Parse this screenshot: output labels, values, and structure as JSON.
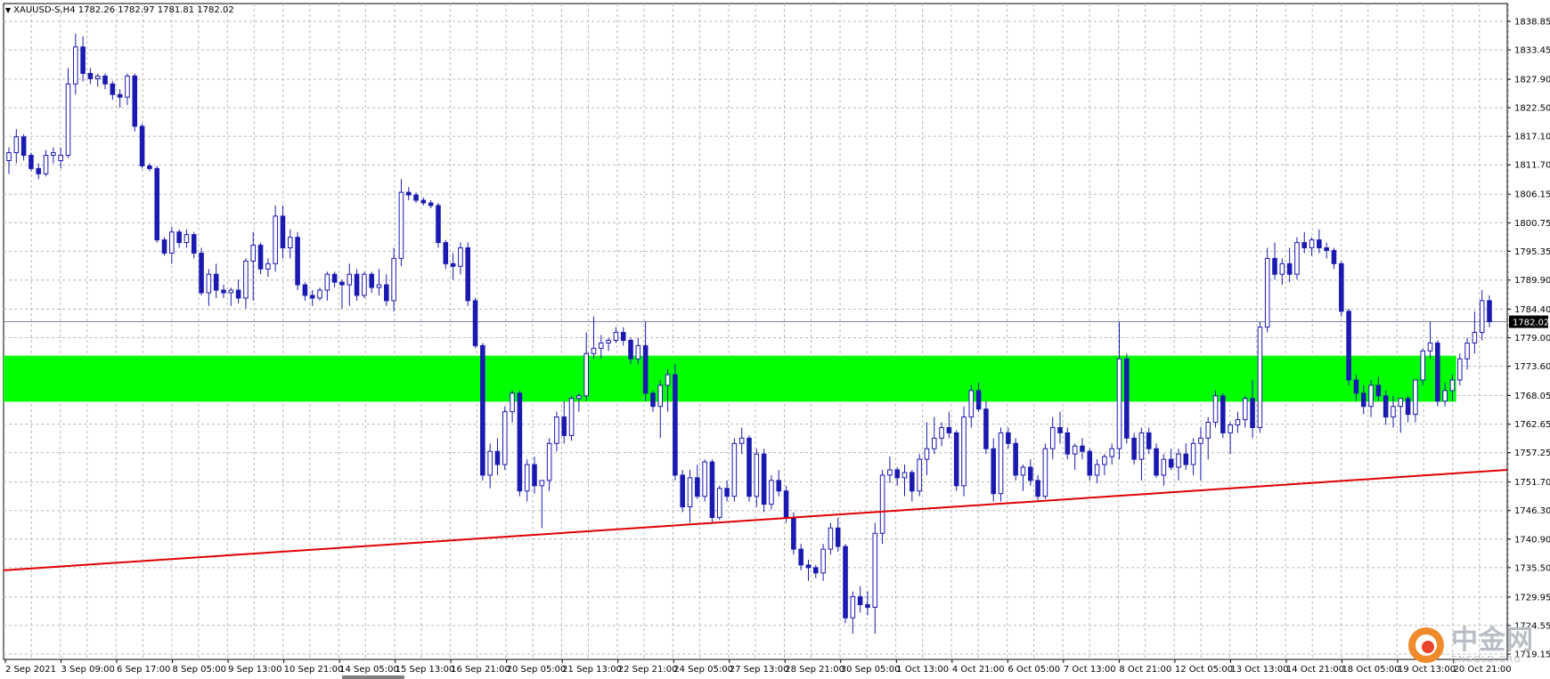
{
  "chart_data": {
    "type": "candlestick",
    "title": "XAUUSD-S,H4  1782.26 1782.97 1781.81 1782.02",
    "ylim": [
      1719.15,
      1841.2
    ],
    "y_ticks": [
      "1838.85",
      "1833.45",
      "1827.90",
      "1822.50",
      "1817.10",
      "1811.70",
      "1806.15",
      "1800.75",
      "1795.35",
      "1789.90",
      "1784.40",
      "1779.00",
      "1773.60",
      "1768.05",
      "1762.65",
      "1757.25",
      "1751.70",
      "1746.30",
      "1740.90",
      "1735.50",
      "1729.95",
      "1724.55",
      "1719.15"
    ],
    "x_labels": [
      "2 Sep 2021",
      "3 Sep 09:00",
      "6 Sep 17:00",
      "8 Sep 05:00",
      "9 Sep 13:00",
      "10 Sep 21:00",
      "14 Sep 05:00",
      "15 Sep 13:00",
      "16 Sep 21:00",
      "20 Sep 05:00",
      "21 Sep 13:00",
      "22 Sep 21:00",
      "24 Sep 05:00",
      "27 Sep 13:00",
      "28 Sep 21:00",
      "30 Sep 05:00",
      "1 Oct 13:00",
      "4 Oct 21:00",
      "6 Oct 05:00",
      "7 Oct 13:00",
      "8 Oct 21:00",
      "12 Oct 05:00",
      "13 Oct 13:00",
      "14 Oct 21:00",
      "18 Oct 05:00",
      "19 Oct 13:00",
      "20 Oct 21:00"
    ],
    "current_price": "1782.02",
    "grid": true,
    "candle_color": "#1a1ab0",
    "zone": {
      "low": 1766.9,
      "high": 1775.6,
      "color": "#00ff00"
    },
    "trendline": {
      "from": [
        0,
        1735.0
      ],
      "to": [
        1,
        1754.0
      ],
      "color": "#e00000"
    },
    "ohlc": [
      [
        1812.5,
        1815.0,
        1810.0,
        1814.0
      ],
      [
        1814.0,
        1818.5,
        1812.0,
        1817.0
      ],
      [
        1817.0,
        1817.5,
        1812.5,
        1813.5
      ],
      [
        1813.5,
        1814.0,
        1810.5,
        1811.0
      ],
      [
        1811.0,
        1812.0,
        1809.0,
        1810.0
      ],
      [
        1810.0,
        1814.5,
        1809.5,
        1813.5
      ],
      [
        1813.5,
        1815.0,
        1812.0,
        1814.0
      ],
      [
        1812.5,
        1815.0,
        1811.0,
        1813.5
      ],
      [
        1813.5,
        1830.0,
        1813.0,
        1827.0
      ],
      [
        1827.0,
        1836.5,
        1825.0,
        1834.0
      ],
      [
        1834.0,
        1836.0,
        1827.5,
        1829.0
      ],
      [
        1829.0,
        1830.0,
        1827.0,
        1828.0
      ],
      [
        1828.0,
        1829.0,
        1826.5,
        1828.5
      ],
      [
        1828.5,
        1829.0,
        1826.0,
        1827.0
      ],
      [
        1827.0,
        1827.5,
        1824.0,
        1825.0
      ],
      [
        1825.0,
        1826.0,
        1822.5,
        1824.5
      ],
      [
        1824.5,
        1829.0,
        1823.0,
        1828.5
      ],
      [
        1828.5,
        1829.0,
        1818.0,
        1819.0
      ],
      [
        1819.0,
        1819.5,
        1811.0,
        1811.5
      ],
      [
        1811.5,
        1812.0,
        1810.5,
        1811.0
      ],
      [
        1811.0,
        1811.5,
        1797.0,
        1797.5
      ],
      [
        1797.5,
        1798.0,
        1794.5,
        1795.0
      ],
      [
        1795.0,
        1800.0,
        1793.0,
        1799.0
      ],
      [
        1799.0,
        1799.5,
        1796.0,
        1797.0
      ],
      [
        1797.0,
        1799.5,
        1796.0,
        1798.5
      ],
      [
        1798.5,
        1799.0,
        1794.0,
        1795.0
      ],
      [
        1795.0,
        1796.0,
        1787.0,
        1787.5
      ],
      [
        1787.5,
        1792.0,
        1785.0,
        1791.0
      ],
      [
        1791.0,
        1793.0,
        1786.5,
        1788.0
      ],
      [
        1788.0,
        1789.0,
        1786.5,
        1787.5
      ],
      [
        1787.5,
        1788.5,
        1785.0,
        1788.0
      ],
      [
        1788.0,
        1790.0,
        1785.5,
        1786.5
      ],
      [
        1786.5,
        1794.0,
        1784.5,
        1793.5
      ],
      [
        1793.5,
        1799.0,
        1786.0,
        1796.5
      ],
      [
        1796.5,
        1797.0,
        1791.0,
        1792.0
      ],
      [
        1792.0,
        1794.0,
        1790.5,
        1793.0
      ],
      [
        1793.0,
        1804.0,
        1791.5,
        1802.0
      ],
      [
        1802.0,
        1804.0,
        1794.0,
        1796.0
      ],
      [
        1796.0,
        1799.5,
        1794.0,
        1798.0
      ],
      [
        1798.0,
        1799.0,
        1788.0,
        1789.0
      ],
      [
        1789.0,
        1789.5,
        1786.0,
        1787.0
      ],
      [
        1787.0,
        1788.0,
        1785.0,
        1786.5
      ],
      [
        1786.5,
        1788.5,
        1786.0,
        1788.0
      ],
      [
        1788.0,
        1791.5,
        1786.0,
        1791.0
      ],
      [
        1791.0,
        1791.5,
        1788.5,
        1789.5
      ],
      [
        1789.5,
        1790.0,
        1784.5,
        1789.0
      ],
      [
        1789.0,
        1793.0,
        1785.0,
        1791.0
      ],
      [
        1791.0,
        1792.0,
        1786.0,
        1787.0
      ],
      [
        1787.0,
        1791.5,
        1786.5,
        1791.0
      ],
      [
        1791.0,
        1791.5,
        1787.5,
        1788.5
      ],
      [
        1788.5,
        1792.0,
        1787.0,
        1789.0
      ],
      [
        1789.0,
        1791.0,
        1785.0,
        1786.0
      ],
      [
        1786.0,
        1796.0,
        1784.0,
        1794.0
      ],
      [
        1794.0,
        1809.0,
        1792.5,
        1806.5
      ],
      [
        1806.5,
        1807.5,
        1805.0,
        1806.0
      ],
      [
        1806.0,
        1806.5,
        1804.5,
        1805.0
      ],
      [
        1805.0,
        1805.5,
        1804.0,
        1804.5
      ],
      [
        1804.5,
        1805.0,
        1803.5,
        1804.0
      ],
      [
        1804.0,
        1804.5,
        1796.0,
        1797.0
      ],
      [
        1797.0,
        1797.5,
        1792.0,
        1793.0
      ],
      [
        1793.0,
        1795.0,
        1790.0,
        1792.5
      ],
      [
        1792.5,
        1797.0,
        1791.0,
        1796.0
      ],
      [
        1796.0,
        1797.0,
        1785.0,
        1786.0
      ],
      [
        1786.0,
        1786.5,
        1777.0,
        1777.5
      ],
      [
        1777.5,
        1778.0,
        1752.0,
        1753.0
      ],
      [
        1753.0,
        1759.0,
        1750.5,
        1757.5
      ],
      [
        1757.5,
        1760.0,
        1753.0,
        1755.0
      ],
      [
        1755.0,
        1766.0,
        1754.0,
        1765.0
      ],
      [
        1765.0,
        1769.0,
        1763.0,
        1768.5
      ],
      [
        1768.5,
        1769.0,
        1749.0,
        1750.0
      ],
      [
        1750.0,
        1756.0,
        1748.0,
        1755.0
      ],
      [
        1755.0,
        1756.5,
        1749.5,
        1751.0
      ],
      [
        1751.0,
        1752.0,
        1743.0,
        1752.0
      ],
      [
        1752.0,
        1760.0,
        1750.0,
        1759.0
      ],
      [
        1759.0,
        1765.0,
        1757.5,
        1764.0
      ],
      [
        1764.0,
        1767.0,
        1759.0,
        1760.5
      ],
      [
        1760.5,
        1768.0,
        1759.5,
        1767.5
      ],
      [
        1767.5,
        1768.5,
        1765.0,
        1768.0
      ],
      [
        1768.0,
        1780.0,
        1767.0,
        1776.0
      ],
      [
        1776.0,
        1783.0,
        1775.0,
        1777.0
      ],
      [
        1777.0,
        1779.5,
        1775.0,
        1778.0
      ],
      [
        1778.0,
        1779.0,
        1776.5,
        1778.5
      ],
      [
        1778.5,
        1781.0,
        1778.0,
        1780.0
      ],
      [
        1780.0,
        1781.0,
        1777.5,
        1778.5
      ],
      [
        1778.5,
        1779.0,
        1774.0,
        1775.0
      ],
      [
        1775.0,
        1779.0,
        1774.0,
        1777.5
      ],
      [
        1777.5,
        1782.0,
        1767.0,
        1768.5
      ],
      [
        1768.5,
        1769.0,
        1765.0,
        1766.0
      ],
      [
        1766.0,
        1771.0,
        1760.0,
        1770.0
      ],
      [
        1770.0,
        1773.0,
        1765.0,
        1772.0
      ],
      [
        1772.0,
        1774.0,
        1752.0,
        1753.0
      ],
      [
        1753.0,
        1754.0,
        1746.0,
        1747.0
      ],
      [
        1747.0,
        1754.0,
        1744.0,
        1752.5
      ],
      [
        1752.5,
        1755.0,
        1748.5,
        1749.0
      ],
      [
        1749.0,
        1756.0,
        1748.0,
        1755.5
      ],
      [
        1755.5,
        1756.0,
        1744.0,
        1745.0
      ],
      [
        1745.0,
        1751.0,
        1744.5,
        1750.5
      ],
      [
        1750.5,
        1752.0,
        1748.0,
        1749.0
      ],
      [
        1749.0,
        1760.0,
        1748.0,
        1759.0
      ],
      [
        1759.0,
        1762.0,
        1757.0,
        1760.0
      ],
      [
        1760.0,
        1760.5,
        1748.0,
        1749.0
      ],
      [
        1749.0,
        1758.0,
        1747.0,
        1757.0
      ],
      [
        1757.0,
        1758.0,
        1746.0,
        1747.5
      ],
      [
        1747.5,
        1753.0,
        1746.5,
        1752.0
      ],
      [
        1752.0,
        1754.0,
        1749.0,
        1750.0
      ],
      [
        1750.0,
        1751.0,
        1744.0,
        1745.0
      ],
      [
        1745.0,
        1746.0,
        1738.0,
        1739.0
      ],
      [
        1739.0,
        1740.0,
        1735.0,
        1736.0
      ],
      [
        1736.0,
        1737.0,
        1733.0,
        1735.5
      ],
      [
        1735.5,
        1736.0,
        1733.5,
        1734.5
      ],
      [
        1734.5,
        1740.0,
        1733.0,
        1739.0
      ],
      [
        1739.0,
        1744.0,
        1738.0,
        1743.0
      ],
      [
        1743.0,
        1745.0,
        1738.5,
        1739.5
      ],
      [
        1739.5,
        1740.0,
        1725.0,
        1726.0
      ],
      [
        1726.0,
        1731.0,
        1723.0,
        1730.0
      ],
      [
        1730.0,
        1732.0,
        1727.0,
        1728.5
      ],
      [
        1728.5,
        1731.0,
        1726.5,
        1728.0
      ],
      [
        1728.0,
        1744.0,
        1723.0,
        1742.0
      ],
      [
        1742.0,
        1754.0,
        1740.0,
        1753.0
      ],
      [
        1753.0,
        1756.5,
        1751.5,
        1754.0
      ],
      [
        1754.0,
        1754.5,
        1751.0,
        1752.5
      ],
      [
        1752.5,
        1755.0,
        1749.0,
        1753.5
      ],
      [
        1753.5,
        1754.0,
        1748.0,
        1750.0
      ],
      [
        1750.0,
        1757.0,
        1749.0,
        1756.0
      ],
      [
        1756.0,
        1763.0,
        1753.0,
        1758.0
      ],
      [
        1758.0,
        1764.0,
        1757.0,
        1760.0
      ],
      [
        1760.0,
        1763.0,
        1758.5,
        1762.0
      ],
      [
        1762.0,
        1765.0,
        1760.0,
        1761.0
      ],
      [
        1761.0,
        1761.5,
        1750.0,
        1751.0
      ],
      [
        1751.0,
        1766.0,
        1749.0,
        1764.0
      ],
      [
        1764.0,
        1770.0,
        1762.0,
        1769.0
      ],
      [
        1769.0,
        1770.5,
        1765.0,
        1765.5
      ],
      [
        1765.5,
        1767.0,
        1757.0,
        1758.0
      ],
      [
        1758.0,
        1760.0,
        1748.0,
        1749.5
      ],
      [
        1749.5,
        1762.0,
        1748.0,
        1761.0
      ],
      [
        1761.0,
        1762.0,
        1758.0,
        1759.0
      ],
      [
        1759.0,
        1760.0,
        1752.0,
        1753.0
      ],
      [
        1753.0,
        1755.0,
        1750.0,
        1754.5
      ],
      [
        1754.5,
        1756.0,
        1751.0,
        1752.0
      ],
      [
        1752.0,
        1753.0,
        1748.0,
        1749.0
      ],
      [
        1749.0,
        1759.0,
        1748.5,
        1758.0
      ],
      [
        1758.0,
        1764.0,
        1756.0,
        1762.0
      ],
      [
        1762.0,
        1765.0,
        1759.0,
        1761.0
      ],
      [
        1761.0,
        1762.0,
        1756.0,
        1757.0
      ],
      [
        1757.0,
        1759.0,
        1754.0,
        1758.5
      ],
      [
        1758.5,
        1760.0,
        1756.0,
        1757.5
      ],
      [
        1757.5,
        1758.0,
        1752.0,
        1753.0
      ],
      [
        1753.0,
        1756.0,
        1751.5,
        1755.0
      ],
      [
        1755.0,
        1757.0,
        1753.0,
        1756.5
      ],
      [
        1756.5,
        1759.0,
        1755.0,
        1758.0
      ],
      [
        1758.0,
        1782.0,
        1756.0,
        1775.0
      ],
      [
        1775.0,
        1776.0,
        1759.0,
        1760.0
      ],
      [
        1760.0,
        1761.0,
        1755.0,
        1756.0
      ],
      [
        1756.0,
        1762.0,
        1752.0,
        1761.0
      ],
      [
        1761.0,
        1762.0,
        1757.0,
        1758.0
      ],
      [
        1758.0,
        1759.0,
        1752.5,
        1753.0
      ],
      [
        1753.0,
        1757.0,
        1751.0,
        1756.0
      ],
      [
        1756.0,
        1758.0,
        1754.0,
        1754.5
      ],
      [
        1754.5,
        1758.0,
        1752.0,
        1757.0
      ],
      [
        1757.0,
        1759.0,
        1754.0,
        1755.0
      ],
      [
        1755.0,
        1760.0,
        1753.0,
        1759.0
      ],
      [
        1759.0,
        1762.0,
        1752.0,
        1760.0
      ],
      [
        1760.0,
        1764.0,
        1756.0,
        1763.0
      ],
      [
        1763.0,
        1769.0,
        1762.0,
        1768.0
      ],
      [
        1768.0,
        1768.5,
        1760.0,
        1761.0
      ],
      [
        1761.0,
        1763.0,
        1757.0,
        1762.5
      ],
      [
        1762.5,
        1765.0,
        1761.0,
        1763.5
      ],
      [
        1763.5,
        1768.0,
        1762.0,
        1767.5
      ],
      [
        1767.5,
        1771.0,
        1760.0,
        1762.0
      ],
      [
        1762.0,
        1782.0,
        1761.0,
        1781.0
      ],
      [
        1781.0,
        1796.0,
        1780.0,
        1794.0
      ],
      [
        1794.0,
        1797.0,
        1790.0,
        1791.0
      ],
      [
        1791.0,
        1794.0,
        1789.0,
        1793.0
      ],
      [
        1793.0,
        1796.0,
        1789.5,
        1791.0
      ],
      [
        1791.0,
        1798.0,
        1790.0,
        1797.0
      ],
      [
        1797.0,
        1799.0,
        1795.0,
        1796.0
      ],
      [
        1796.0,
        1798.0,
        1794.5,
        1797.5
      ],
      [
        1797.5,
        1799.5,
        1795.0,
        1796.0
      ],
      [
        1796.0,
        1797.0,
        1794.0,
        1795.5
      ],
      [
        1795.5,
        1796.0,
        1792.0,
        1793.0
      ],
      [
        1793.0,
        1793.5,
        1783.0,
        1784.0
      ],
      [
        1784.0,
        1784.5,
        1770.0,
        1771.0
      ],
      [
        1771.0,
        1772.0,
        1767.0,
        1768.5
      ],
      [
        1768.5,
        1770.0,
        1764.5,
        1766.0
      ],
      [
        1766.0,
        1771.0,
        1764.0,
        1770.0
      ],
      [
        1770.0,
        1771.5,
        1767.0,
        1768.0
      ],
      [
        1768.0,
        1769.0,
        1762.5,
        1764.0
      ],
      [
        1764.0,
        1768.0,
        1762.0,
        1766.0
      ],
      [
        1766.0,
        1767.0,
        1761.0,
        1767.5
      ],
      [
        1767.5,
        1768.0,
        1763.0,
        1764.5
      ],
      [
        1764.5,
        1770.0,
        1763.0,
        1771.0
      ],
      [
        1771.0,
        1777.0,
        1770.0,
        1776.5
      ],
      [
        1776.5,
        1782.0,
        1775.0,
        1778.0
      ],
      [
        1778.0,
        1778.5,
        1766.0,
        1767.0
      ],
      [
        1767.0,
        1770.5,
        1766.0,
        1769.0
      ],
      [
        1769.0,
        1772.0,
        1767.0,
        1771.0
      ],
      [
        1771.0,
        1776.0,
        1770.0,
        1775.0
      ],
      [
        1775.0,
        1779.0,
        1773.0,
        1778.0
      ],
      [
        1778.0,
        1784.0,
        1776.0,
        1780.0
      ],
      [
        1780.0,
        1788.0,
        1778.5,
        1786.0
      ],
      [
        1786.0,
        1787.0,
        1781.0,
        1782.02
      ]
    ]
  }
}
